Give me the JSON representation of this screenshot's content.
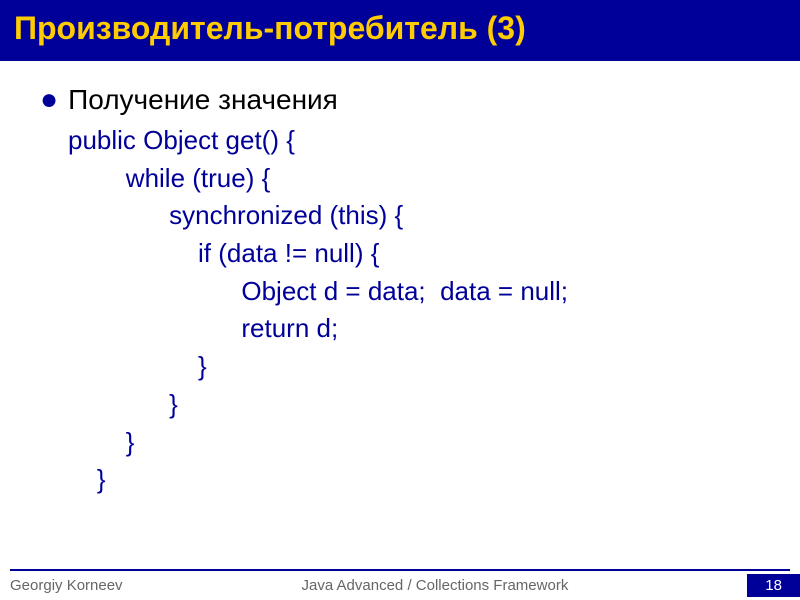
{
  "header": {
    "title": "Производитель-потребитель (3)"
  },
  "content": {
    "bullet": "Получение значения",
    "code": {
      "line1": "public Object get() {",
      "line2": "        while (true) {",
      "line3": "              synchronized (this) {",
      "line4": "                  if (data != null) {",
      "line5": "                        Object d = data;  data = null;",
      "line6": "                        return d;",
      "line7": "                  }",
      "line8": "              }",
      "line9": "        }",
      "line10": "    }"
    }
  },
  "footer": {
    "author": "Georgiy Korneev",
    "course": "Java Advanced / Collections Framework",
    "page": "18"
  }
}
